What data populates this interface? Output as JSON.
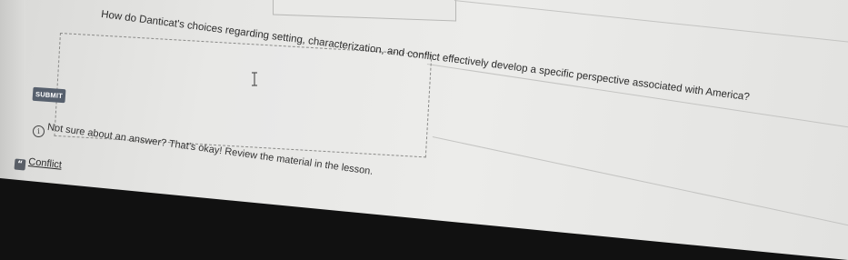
{
  "question": {
    "text": "How do Danticat's choices regarding setting, characterization, and conflict effectively develop a specific perspective associated with America?"
  },
  "answer_input": {
    "value": ""
  },
  "submit": {
    "label": "SUBMIT"
  },
  "help": {
    "icon_glyph": "i",
    "text": "Not sure about an answer? That's okay! Review the material in the lesson."
  },
  "reference": {
    "icon": "quote-icon",
    "icon_glyph": "“",
    "label": "Conflict"
  },
  "colors": {
    "submit_bg": "#57606d",
    "page_bg": "#e6e6e4"
  }
}
